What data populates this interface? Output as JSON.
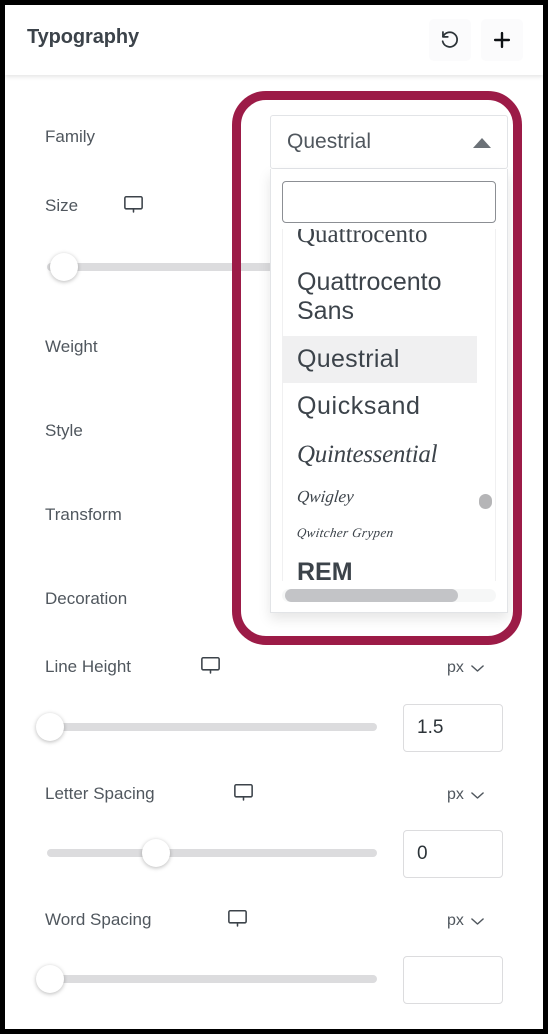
{
  "header": {
    "title": "Typography",
    "reset_button": "reset-icon",
    "add_button": "plus-icon"
  },
  "controls": {
    "family": {
      "label": "Family"
    },
    "size": {
      "label": "Size",
      "device_icon": "desktop-icon",
      "slider_percent": 4
    },
    "weight": {
      "label": "Weight"
    },
    "style": {
      "label": "Style"
    },
    "transform": {
      "label": "Transform"
    },
    "decoration": {
      "label": "Decoration"
    },
    "line_height": {
      "label": "Line Height",
      "device_icon": "desktop-icon",
      "unit": "px",
      "value": "1.5",
      "slider_percent": 1
    },
    "letter_spacing": {
      "label": "Letter Spacing",
      "device_icon": "desktop-icon",
      "unit": "px",
      "value": "0",
      "slider_percent": 33
    },
    "word_spacing": {
      "label": "Word Spacing",
      "device_icon": "desktop-icon",
      "unit": "px",
      "value": "",
      "placeholder": "",
      "slider_percent": 1
    }
  },
  "font_family_dropdown": {
    "selected": "Questrial",
    "expanded": true,
    "caret_icon": "caret-up-icon",
    "search_value": "",
    "search_placeholder": "",
    "options": [
      {
        "label": "Quattrocento",
        "selected": false,
        "clipped": true
      },
      {
        "label": "Quattrocento Sans",
        "selected": false,
        "clipped": false
      },
      {
        "label": "Questrial",
        "selected": true,
        "clipped": false
      },
      {
        "label": "Quicksand",
        "selected": false,
        "clipped": false
      },
      {
        "label": "Quintessential",
        "selected": false,
        "clipped": false
      },
      {
        "label": "Qwigley",
        "selected": false,
        "clipped": false
      },
      {
        "label": "Qwitcher Grypen",
        "selected": false,
        "clipped": false
      },
      {
        "label": "REM",
        "selected": false,
        "clipped": true
      }
    ]
  },
  "highlight": {
    "color": "#9c1b47",
    "target": "font-family-dropdown"
  },
  "colors": {
    "label_text": "#50575e",
    "title_text": "#3c434a",
    "slider_track": "#dcdcde",
    "border": "#dcdcde",
    "selected_row": "#f0f0f1",
    "accent": "#9c1b47"
  }
}
